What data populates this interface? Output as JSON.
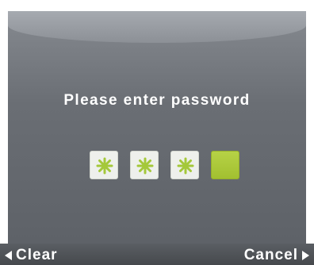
{
  "prompt": "Please enter password",
  "password": {
    "digits_entered": 3,
    "length": 4,
    "masked_glyph": "*"
  },
  "softkeys": {
    "left_label": "Clear",
    "right_label": "Cancel"
  },
  "colors": {
    "accent": "#a8c634",
    "mask_star": "#a4c83a",
    "panel": "#6a6e74",
    "bottom_bar": "#4e5155"
  }
}
